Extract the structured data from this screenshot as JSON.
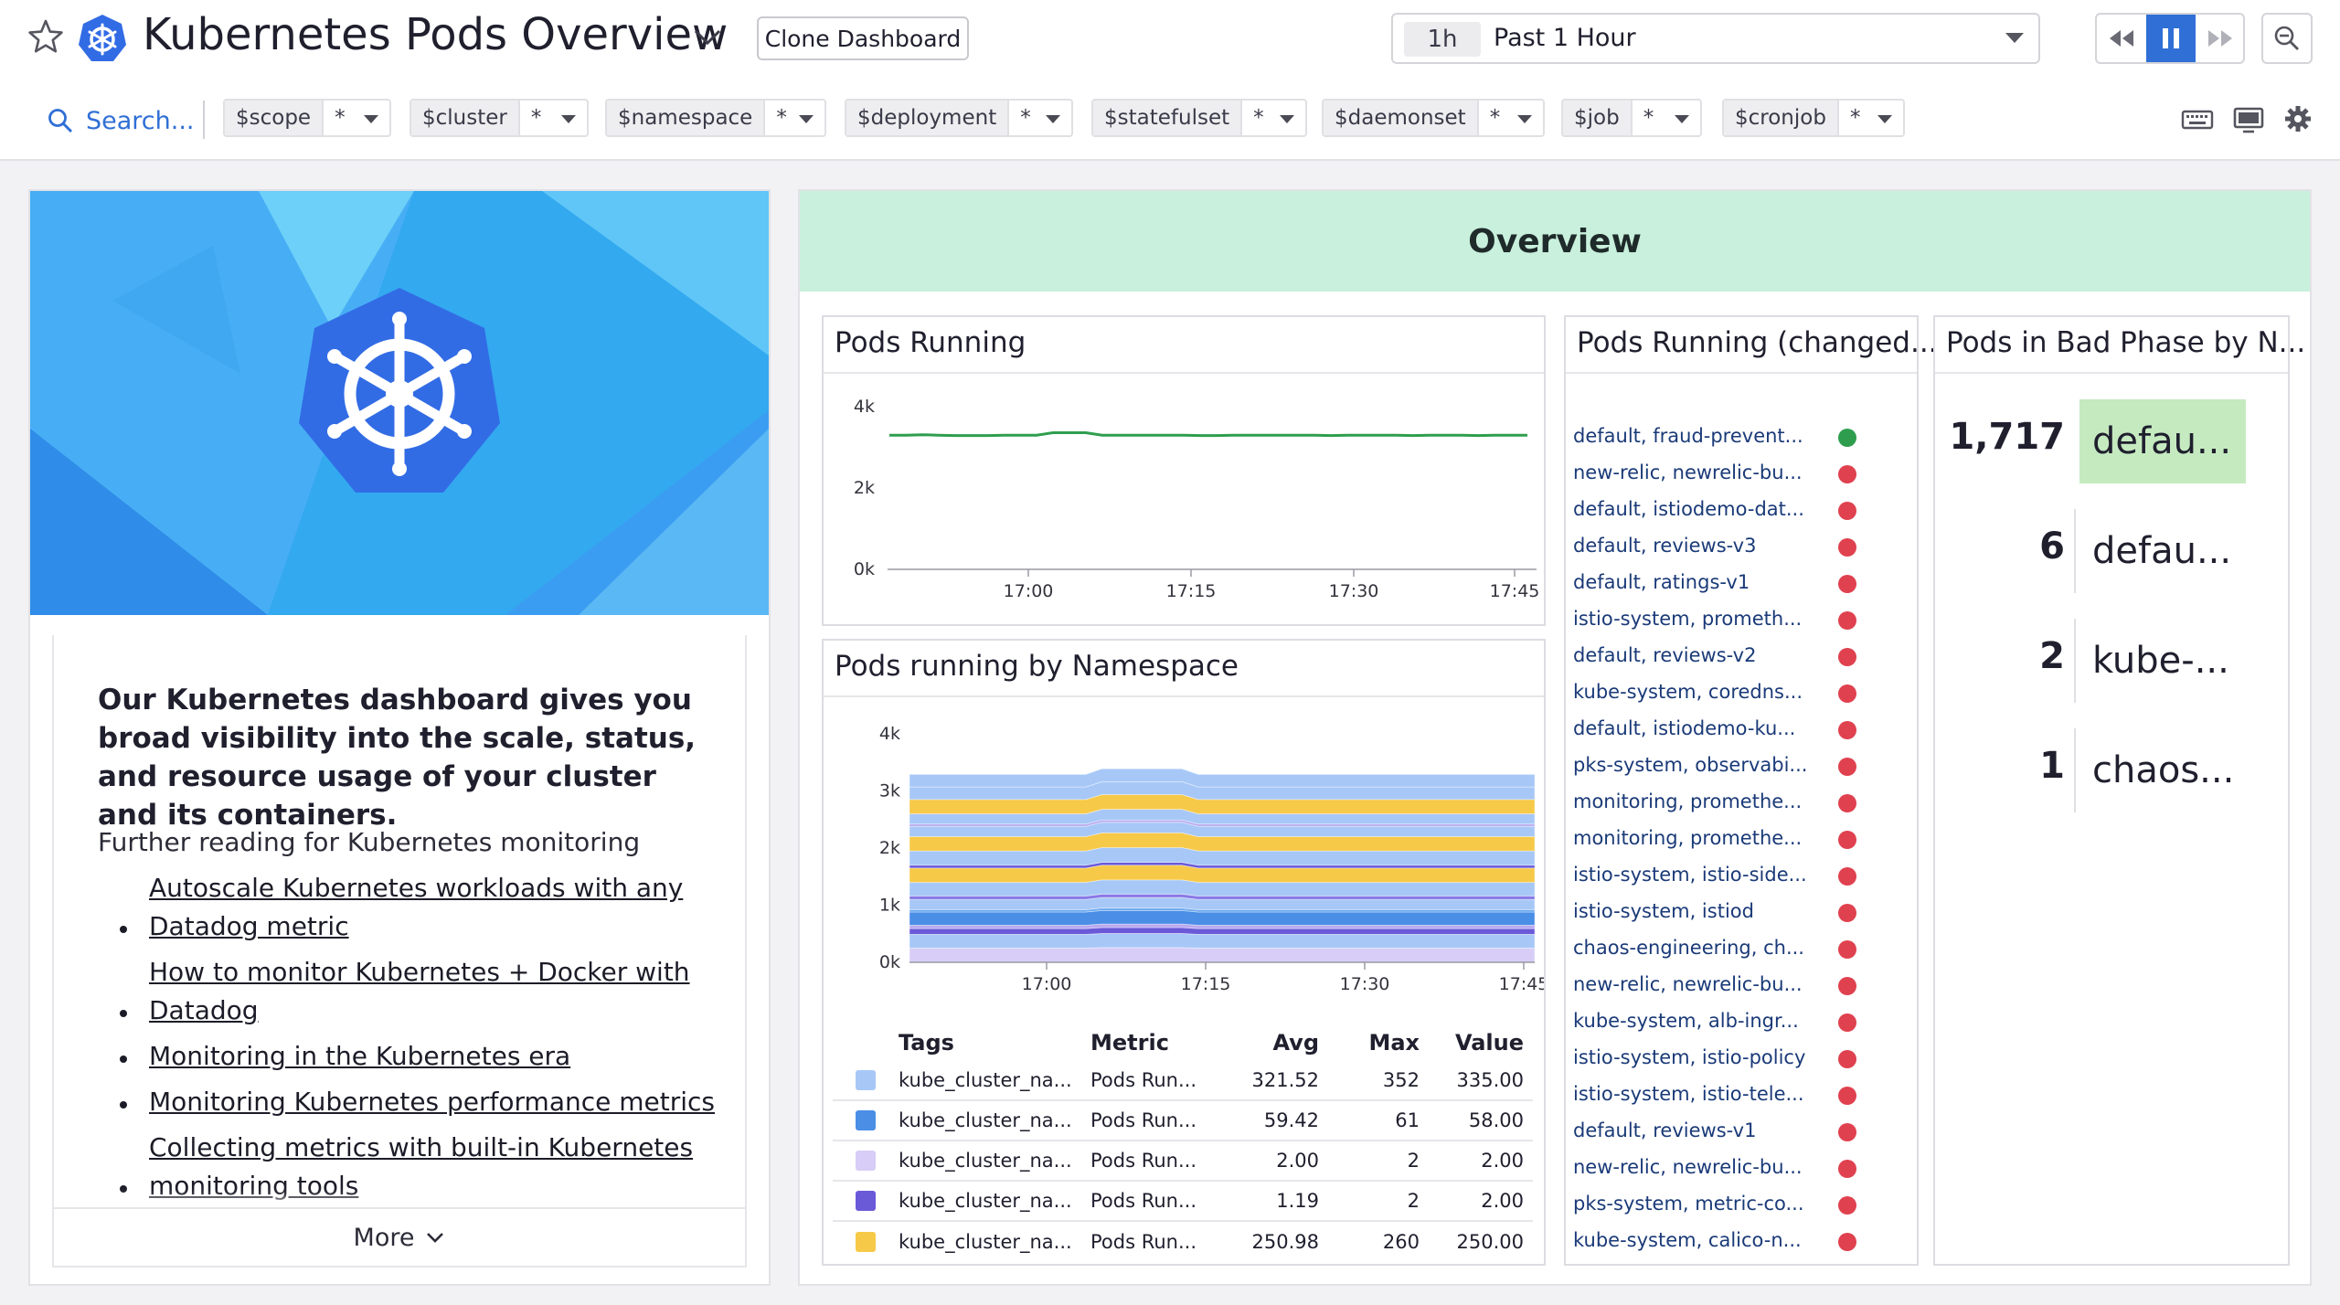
{
  "header": {
    "title": "Kubernetes Pods Overview",
    "clone_label": "Clone Dashboard",
    "time_chip": "1h",
    "time_label": "Past 1 Hour",
    "search_label": "Search..."
  },
  "template_vars": [
    {
      "name": "$scope",
      "value": "*"
    },
    {
      "name": "$cluster",
      "value": "*"
    },
    {
      "name": "$namespace",
      "value": "*"
    },
    {
      "name": "$deployment",
      "value": "*"
    },
    {
      "name": "$statefulset",
      "value": "*"
    },
    {
      "name": "$daemonset",
      "value": "*"
    },
    {
      "name": "$job",
      "value": "*"
    },
    {
      "name": "$cronjob",
      "value": "*"
    }
  ],
  "intro": {
    "bold_text": "Our Kubernetes dashboard gives you broad visibility into the scale, status, and resource usage of your cluster and its containers.",
    "further_reading": "Further reading for Kubernetes monitoring",
    "links": [
      "Autoscale Kubernetes workloads with any Datadog metric",
      "How to monitor Kubernetes + Docker with Datadog",
      "Monitoring in the Kubernetes era",
      "Monitoring Kubernetes performance metrics",
      "Collecting metrics with built-in Kubernetes monitoring tools"
    ],
    "more_label": "More"
  },
  "overview": {
    "title": "Overview"
  },
  "pods_running": {
    "title": "Pods Running"
  },
  "pods_by_namespace": {
    "title": "Pods running by Namespace",
    "table_headers": {
      "tags": "Tags",
      "metric": "Metric",
      "avg": "Avg",
      "max": "Max",
      "value": "Value"
    },
    "rows": [
      {
        "color": "#a7c8f7",
        "tag": "kube_cluster_na...",
        "metric": "Pods Run...",
        "avg": "321.52",
        "max": "352",
        "value": "335.00"
      },
      {
        "color": "#4a8ee6",
        "tag": "kube_cluster_na...",
        "metric": "Pods Run...",
        "avg": "59.42",
        "max": "61",
        "value": "58.00"
      },
      {
        "color": "#d8cdf7",
        "tag": "kube_cluster_na...",
        "metric": "Pods Run...",
        "avg": "2.00",
        "max": "2",
        "value": "2.00"
      },
      {
        "color": "#6a5ad8",
        "tag": "kube_cluster_na...",
        "metric": "Pods Run...",
        "avg": "1.19",
        "max": "2",
        "value": "2.00"
      },
      {
        "color": "#f7c948",
        "tag": "kube_cluster_na...",
        "metric": "Pods Run...",
        "avg": "250.98",
        "max": "260",
        "value": "250.00"
      }
    ]
  },
  "pods_running_changed": {
    "title": "Pods Running (changed...",
    "items": [
      {
        "label": "default, fraud-prevent...",
        "status": "ok"
      },
      {
        "label": "new-relic, newrelic-bu...",
        "status": "alert"
      },
      {
        "label": "default, istiodemo-dat...",
        "status": "alert"
      },
      {
        "label": "default, reviews-v3",
        "status": "alert"
      },
      {
        "label": "default, ratings-v1",
        "status": "alert"
      },
      {
        "label": "istio-system, prometh...",
        "status": "alert"
      },
      {
        "label": "default, reviews-v2",
        "status": "alert"
      },
      {
        "label": "kube-system, coredns...",
        "status": "alert"
      },
      {
        "label": "default, istiodemo-ku...",
        "status": "alert"
      },
      {
        "label": "pks-system, observabi...",
        "status": "alert"
      },
      {
        "label": "monitoring, promethe...",
        "status": "alert"
      },
      {
        "label": "monitoring, promethe...",
        "status": "alert"
      },
      {
        "label": "istio-system, istio-side...",
        "status": "alert"
      },
      {
        "label": "istio-system, istiod",
        "status": "alert"
      },
      {
        "label": "chaos-engineering, ch...",
        "status": "alert"
      },
      {
        "label": "new-relic, newrelic-bu...",
        "status": "alert"
      },
      {
        "label": "kube-system, alb-ingr...",
        "status": "alert"
      },
      {
        "label": "istio-system, istio-policy",
        "status": "alert"
      },
      {
        "label": "istio-system, istio-tele...",
        "status": "alert"
      },
      {
        "label": "default, reviews-v1",
        "status": "alert"
      },
      {
        "label": "new-relic, newrelic-bu...",
        "status": "alert"
      },
      {
        "label": "pks-system, metric-co...",
        "status": "alert"
      },
      {
        "label": "kube-system, calico-n...",
        "status": "alert"
      }
    ],
    "colors": {
      "ok": "#2e9e4e",
      "alert": "#e0414f"
    }
  },
  "bad_phase": {
    "title": "Pods in Bad Phase by N...",
    "rows": [
      {
        "value": "1,717",
        "label": "defau...",
        "highlight": true
      },
      {
        "value": "6",
        "label": "defau...",
        "highlight": false
      },
      {
        "value": "2",
        "label": "kube-...",
        "highlight": false
      },
      {
        "value": "1",
        "label": "chaos...",
        "highlight": false
      }
    ],
    "highlight_color": "#c5eac0"
  },
  "chart_data": [
    {
      "type": "line",
      "title": "Pods Running",
      "x_ticks": [
        "17:00",
        "17:15",
        "17:30",
        "17:45"
      ],
      "y_ticks": [
        "0k",
        "2k",
        "4k"
      ],
      "ylim": [
        0,
        4000
      ],
      "series": [
        {
          "color": "#2e9e4e",
          "values": [
            3300,
            3300,
            3310,
            3300,
            3290,
            3290,
            3290,
            3300,
            3300,
            3300,
            3360,
            3360,
            3360,
            3300,
            3300,
            3300,
            3300,
            3300,
            3300,
            3290,
            3290,
            3300,
            3300,
            3300,
            3300,
            3300,
            3300,
            3290,
            3300,
            3300,
            3300,
            3300,
            3290,
            3300,
            3300,
            3300,
            3290,
            3300,
            3300,
            3300
          ]
        }
      ]
    },
    {
      "type": "area",
      "title": "Pods running by Namespace",
      "x_ticks": [
        "17:00",
        "17:15",
        "17:30",
        "17:45"
      ],
      "y_ticks": [
        "0k",
        "1k",
        "2k",
        "3k",
        "4k"
      ],
      "ylim": [
        0,
        4000
      ],
      "stack_colors": [
        "#d8cdf7",
        "#a7c8f7",
        "#6a5ad8",
        "#b9a9ef",
        "#4a8ee6",
        "#6aa8ef",
        "#a7c8f7",
        "#8a7ae6",
        "#a7c8f7",
        "#f7c948",
        "#6a5ad8",
        "#a7c8f7",
        "#f7c948",
        "#a7c8f7",
        "#b9a9ef",
        "#a7c8f7",
        "#f7c948",
        "#a7c8f7",
        "#a7c8f7"
      ],
      "stack_values": [
        250,
        240,
        100,
        60,
        230,
        40,
        180,
        60,
        240,
        250,
        50,
        250,
        250,
        180,
        40,
        180,
        250,
        220,
        220
      ],
      "bump": 0.03
    }
  ]
}
